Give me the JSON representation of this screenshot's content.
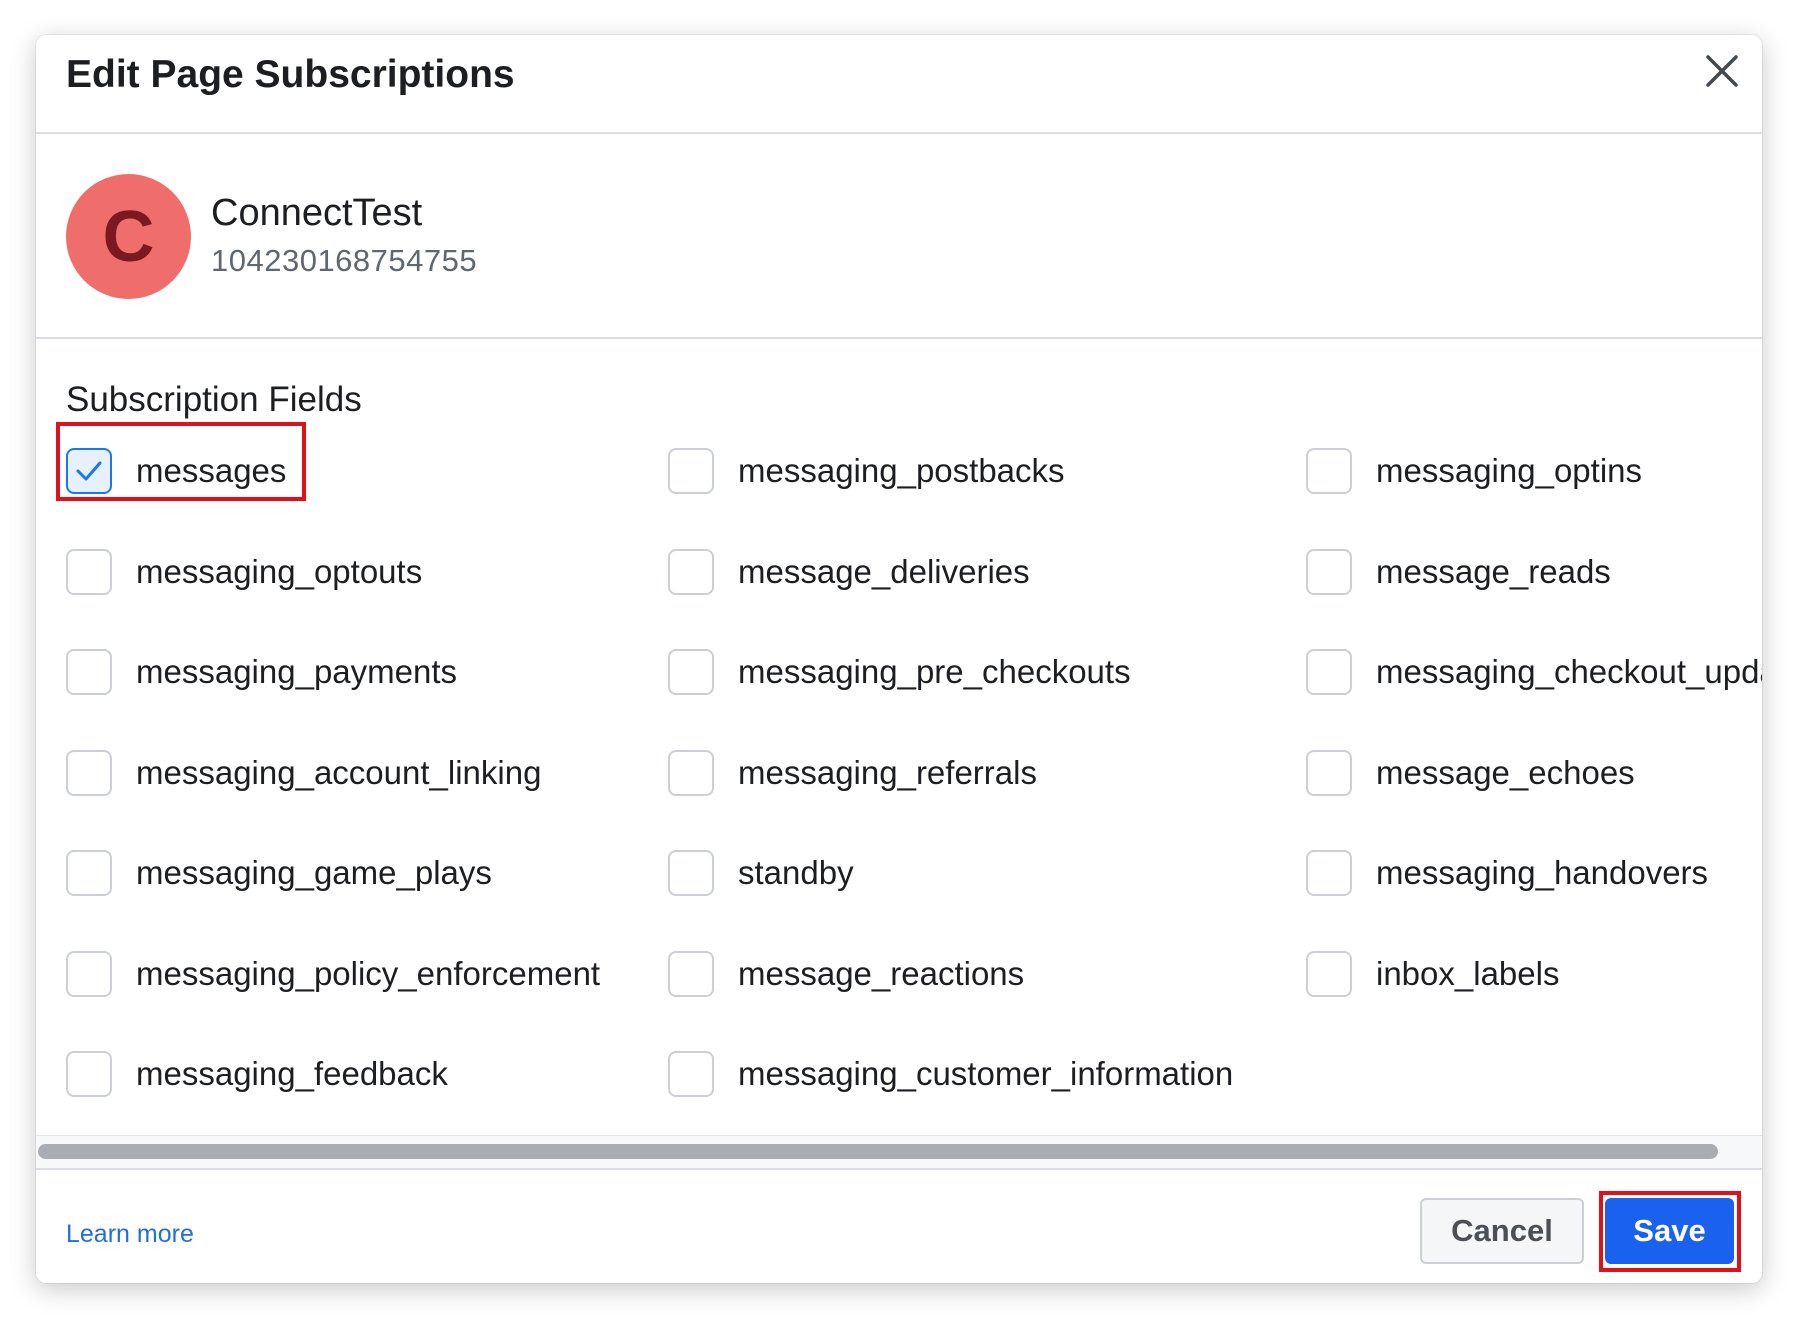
{
  "dialog": {
    "title": "Edit Page Subscriptions",
    "close_icon": "close-icon"
  },
  "page": {
    "avatar_letter": "C",
    "avatar_color": "#ef6e6c",
    "name": "ConnectTest",
    "id": "104230168754755"
  },
  "subscriptions": {
    "section_title": "Subscription Fields",
    "fields": [
      {
        "label": "messages",
        "checked": true,
        "highlighted": true
      },
      {
        "label": "messaging_postbacks",
        "checked": false
      },
      {
        "label": "messaging_optins",
        "checked": false
      },
      {
        "label": "messaging_optouts",
        "checked": false
      },
      {
        "label": "message_deliveries",
        "checked": false
      },
      {
        "label": "message_reads",
        "checked": false
      },
      {
        "label": "messaging_payments",
        "checked": false
      },
      {
        "label": "messaging_pre_checkouts",
        "checked": false
      },
      {
        "label": "messaging_checkout_updates",
        "checked": false
      },
      {
        "label": "messaging_account_linking",
        "checked": false
      },
      {
        "label": "messaging_referrals",
        "checked": false
      },
      {
        "label": "message_echoes",
        "checked": false
      },
      {
        "label": "messaging_game_plays",
        "checked": false
      },
      {
        "label": "standby",
        "checked": false
      },
      {
        "label": "messaging_handovers",
        "checked": false
      },
      {
        "label": "messaging_policy_enforcement",
        "checked": false
      },
      {
        "label": "message_reactions",
        "checked": false
      },
      {
        "label": "inbox_labels",
        "checked": false
      },
      {
        "label": "messaging_feedback",
        "checked": false
      },
      {
        "label": "messaging_customer_information",
        "checked": false
      }
    ]
  },
  "footer": {
    "learn_more": "Learn more",
    "cancel_label": "Cancel",
    "save_label": "Save",
    "save_highlighted": true
  },
  "colors": {
    "accent": "#1b61f0",
    "highlight": "#e0111b",
    "link": "#216fdb"
  }
}
